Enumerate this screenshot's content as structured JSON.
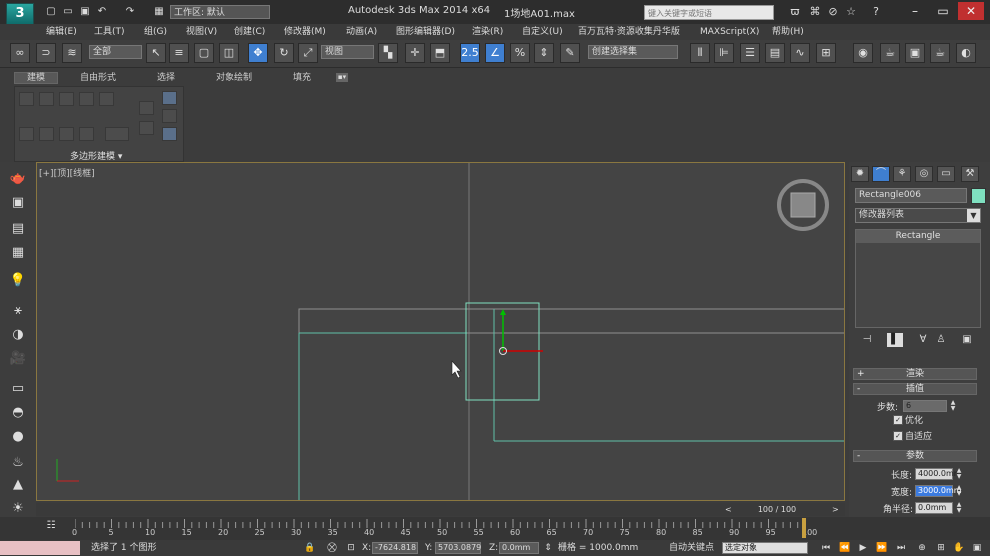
{
  "titlebar": {
    "logo": "3",
    "workspace": "工作区: 默认",
    "title": "Autodesk 3ds Max  2014 x64",
    "file": "1场地A01.max",
    "search_placeholder": "键入关键字或短语"
  },
  "menu": [
    "编辑(E)",
    "工具(T)",
    "组(G)",
    "视图(V)",
    "创建(C)",
    "修改器(M)",
    "动画(A)",
    "图形编辑器(D)",
    "渲染(R)",
    "自定义(U)",
    "百万瓦特·资源收集丹华版",
    "MAXScript(X)",
    "帮助(H)"
  ],
  "toolbar": {
    "selection_filter": "全部",
    "ref_coord": "视图",
    "named_selection": "创建选择集",
    "snap_label": "2.5"
  },
  "ribbon": {
    "tabs": [
      "建模",
      "自由形式",
      "选择",
      "对象绘制",
      "填充"
    ],
    "panel_label": "多边形建模 ▾"
  },
  "viewport": {
    "label": "[+][顶][线框]"
  },
  "command_panel": {
    "object_name": "Rectangle006",
    "modifier_list": "修改器列表",
    "stack_item": "Rectangle",
    "rollouts": {
      "render": "渲染",
      "interpolation": "插值",
      "parameters": "参数"
    },
    "interp": {
      "steps_label": "步数:",
      "steps_value": "6",
      "optimize": "优化",
      "adaptive": "自适应"
    },
    "params": {
      "length_label": "长度:",
      "length_value": "4000.0mm",
      "width_label": "宽度:",
      "width_value": "3000.0mm",
      "corner_label": "角半径:",
      "corner_value": "0.0mm"
    }
  },
  "timeline": {
    "readout": "100 / 100",
    "ticks": [
      "0",
      "5",
      "10",
      "15",
      "20",
      "25",
      "30",
      "35",
      "40",
      "45",
      "50",
      "55",
      "60",
      "65",
      "70",
      "75",
      "80",
      "85",
      "90",
      "95",
      "100"
    ]
  },
  "status": {
    "message": "选择了 1 个图形",
    "x_label": "X:",
    "x_value": "-7624.818",
    "y_label": "Y:",
    "y_value": "5703.0879",
    "z_label": "Z:",
    "z_value": "0.0mm",
    "grid": "栅格 = 1000.0mm",
    "autokey": "自动关键点",
    "key_filter": "选定对象"
  },
  "colors": {
    "viewport_bg": "#444444",
    "selection_cyan": "#7fe0c0",
    "active_blue": "#3f7fd0"
  }
}
